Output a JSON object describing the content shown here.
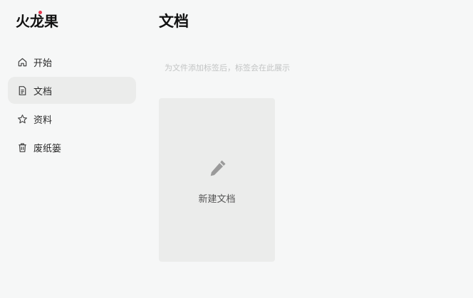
{
  "app": {
    "logo_text": "火龙果",
    "logo_dot_color": "#e8384f"
  },
  "sidebar": {
    "items": [
      {
        "label": "开始",
        "icon": "home-icon",
        "active": false
      },
      {
        "label": "文档",
        "icon": "document-icon",
        "active": true
      },
      {
        "label": "资料",
        "icon": "star-icon",
        "active": false
      },
      {
        "label": "废纸篓",
        "icon": "trash-icon",
        "active": false
      }
    ]
  },
  "main": {
    "title": "文档",
    "tag_hint": "为文件添加标签后，标签会在此展示",
    "new_doc_label": "新建文档",
    "new_doc_icon": "pencil-icon"
  },
  "colors": {
    "background": "#f6f7f7",
    "active_item_bg": "#ebeceb",
    "card_bg": "#ebeceb",
    "brand_accent": "#e8384f"
  }
}
